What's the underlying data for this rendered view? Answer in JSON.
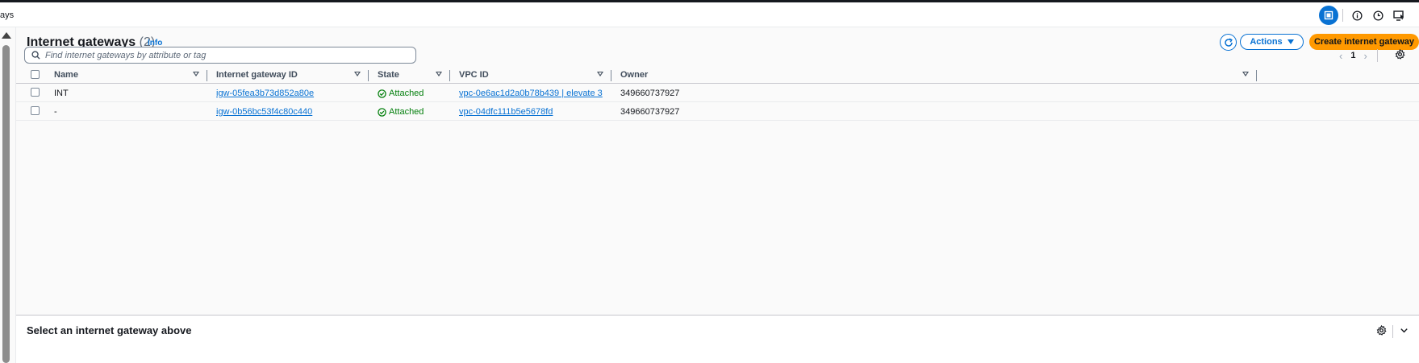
{
  "topbar": {
    "breadcrumb": "ays",
    "icons": [
      "panel-icon",
      "info-icon",
      "history-icon",
      "screen-icon"
    ]
  },
  "header": {
    "title": "Internet gateways",
    "count": "(2)",
    "info": "Info",
    "actions_label": "Actions",
    "create_label": "Create internet gateway"
  },
  "search": {
    "placeholder": "Find internet gateways by attribute or tag"
  },
  "pagination": {
    "current_page": "1"
  },
  "table": {
    "columns": [
      "Name",
      "Internet gateway ID",
      "State",
      "VPC ID",
      "Owner"
    ],
    "rows": [
      {
        "name": "INT",
        "id": "igw-05fea3b73d852a80e",
        "state": "Attached",
        "vpc": "vpc-0e6ac1d2a0b78b439 | elevate 3",
        "owner": "349660737927"
      },
      {
        "name": "-",
        "id": "igw-0b56bc53f4c80c440",
        "state": "Attached",
        "vpc": "vpc-04dfc111b5e5678fd",
        "owner": "349660737927"
      }
    ]
  },
  "details": {
    "title": "Select an internet gateway above"
  },
  "colors": {
    "accent": "#0972d3",
    "primary_button": "#ff9900",
    "success": "#037f0c"
  }
}
